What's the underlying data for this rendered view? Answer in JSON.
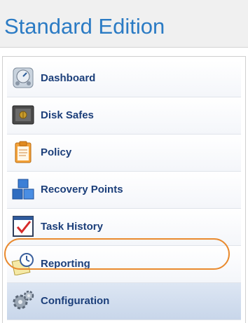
{
  "header": {
    "title": "Standard Edition"
  },
  "nav": {
    "items": [
      {
        "label": "Dashboard",
        "icon": "dashboard-icon"
      },
      {
        "label": "Disk Safes",
        "icon": "safe-icon"
      },
      {
        "label": "Policy",
        "icon": "clipboard-icon"
      },
      {
        "label": "Recovery Points",
        "icon": "cubes-icon"
      },
      {
        "label": "Task History",
        "icon": "checklist-icon"
      },
      {
        "label": "Reporting",
        "icon": "report-clock-icon"
      },
      {
        "label": "Configuration",
        "icon": "gears-icon"
      }
    ],
    "selected": "Configuration"
  },
  "colors": {
    "title": "#2b7bc4",
    "label": "#1c3f7a",
    "highlight": "#e98a2e"
  }
}
